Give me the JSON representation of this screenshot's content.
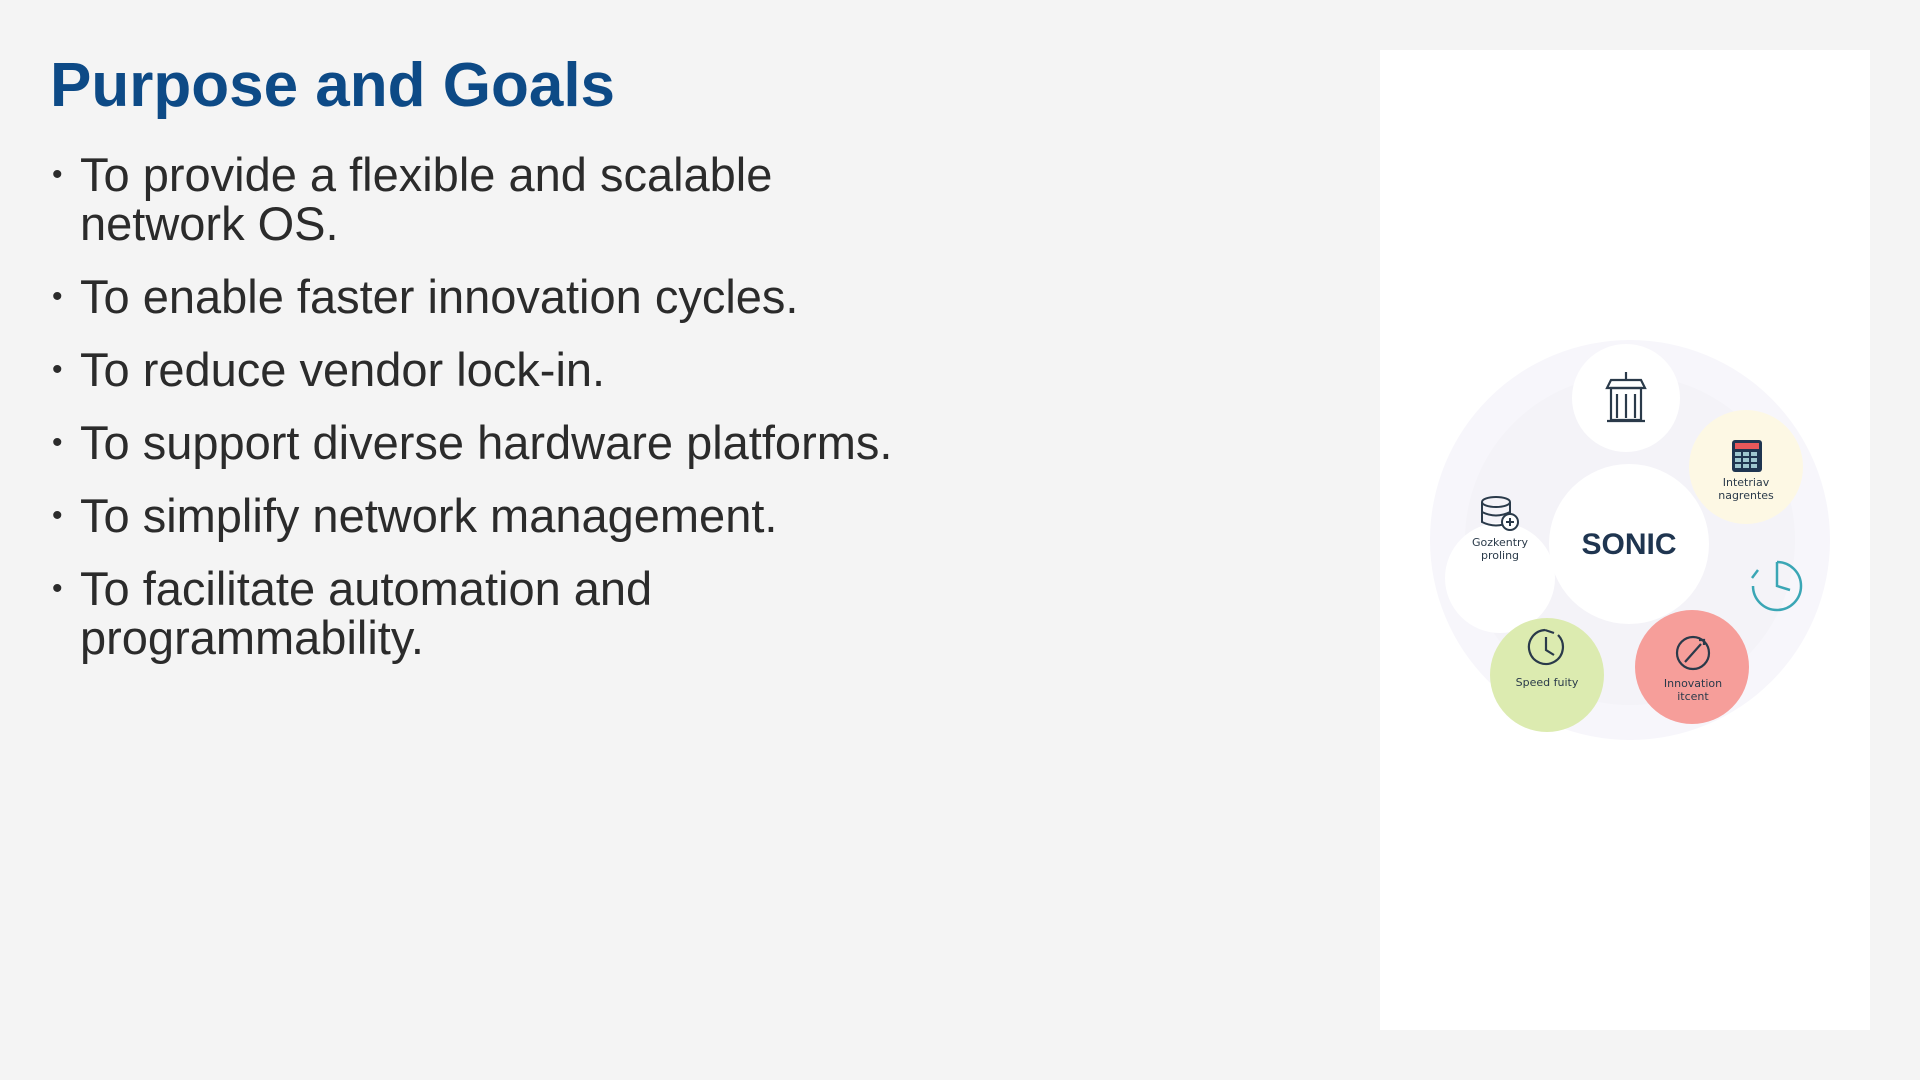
{
  "slide": {
    "title": "Purpose and Goals",
    "bullets": [
      "To provide a flexible and scalable network OS.",
      "To enable faster innovation cycles.",
      "To reduce vendor lock-in.",
      "To support diverse hardware platforms.",
      "To simplify network management.",
      "To facilitate automation and programmability."
    ]
  },
  "illustration": {
    "center_label": "SONIC",
    "nodes": [
      {
        "icon": "building-icon",
        "label_lines": []
      },
      {
        "icon": "calculator-icon",
        "label_lines": [
          "Intetriav",
          "nagrentes"
        ],
        "color": "#fdf8e4"
      },
      {
        "icon": "database-icon",
        "label_lines": [
          "Gozkentry",
          "proling"
        ]
      },
      {
        "icon": "clock-chart-icon",
        "label_lines": []
      },
      {
        "icon": "timer-icon",
        "label_lines": [
          "Speed fuity"
        ],
        "color": "#dcebb0"
      },
      {
        "icon": "compass-icon",
        "label_lines": [
          "Innovation",
          "itcent"
        ],
        "color": "#f69e9a"
      }
    ],
    "colors": {
      "title": "#0d4a86",
      "text": "#2b2b2b",
      "center_text": "#1f3550",
      "icon_teal": "#3aa6b5"
    }
  }
}
